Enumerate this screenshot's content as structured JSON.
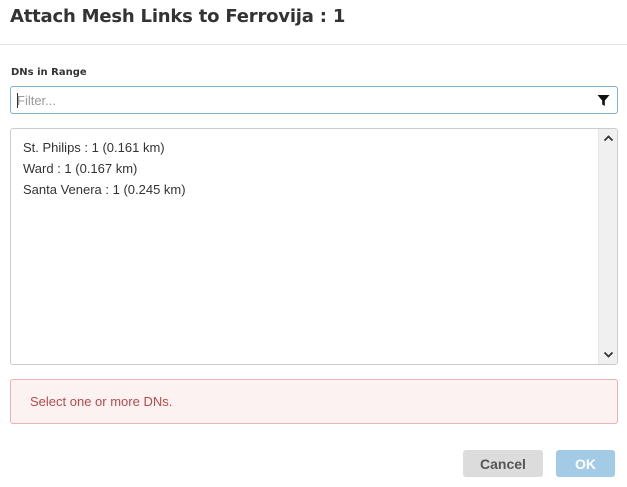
{
  "dialog": {
    "title": "Attach Mesh Links to Ferrovija : 1"
  },
  "filter": {
    "label": "DNs in Range",
    "value": "",
    "placeholder": "Filter...",
    "icon": "filter-icon"
  },
  "list": {
    "items": [
      {
        "label": "St. Philips : 1 (0.161 km)"
      },
      {
        "label": "Ward : 1 (0.167 km)"
      },
      {
        "label": "Santa Venera : 1 (0.245 km)"
      }
    ]
  },
  "alert": {
    "message": "Select one or more DNs."
  },
  "buttons": {
    "cancel_label": "Cancel",
    "ok_label": "OK"
  },
  "colors": {
    "focus_border": "#7fb4c9",
    "alert_text": "#b84a4a",
    "alert_bg": "#fdf2f2",
    "ok_button": "#a4cbe6",
    "cancel_button": "#dcdcdc"
  }
}
